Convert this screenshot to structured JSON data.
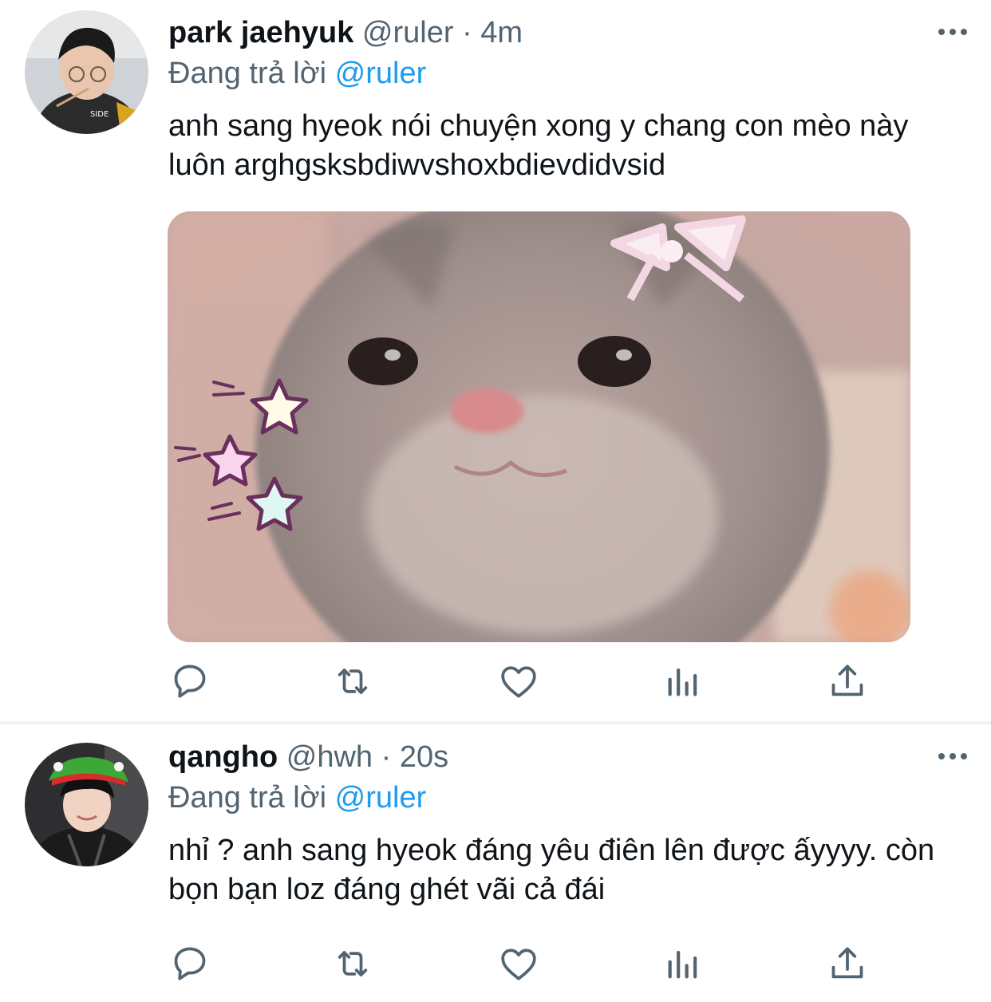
{
  "tweets": [
    {
      "name": "park jaehyuk",
      "handle": "@ruler",
      "separator": "·",
      "time": "4m",
      "reply_prefix": "Đang trả lời",
      "reply_to": "@ruler",
      "text": "anh sang hyeok nói chuyện xong y chang con mèo này luôn arghgsksbdiwvshoxbdievdidvsid",
      "has_media": true
    },
    {
      "name": "qangho",
      "handle": "@hwh",
      "separator": "·",
      "time": "20s",
      "reply_prefix": "Đang trả lời",
      "reply_to": "@ruler",
      "text": "nhỉ ? anh sang hyeok đáng yêu điên lên được ấyyyy. còn bọn bạn loz đáng ghét vãi cả đái",
      "has_media": false
    }
  ],
  "icons": {
    "more": "more-icon",
    "reply": "reply-icon",
    "retweet": "retweet-icon",
    "like": "heart-icon",
    "stats": "stats-icon",
    "share": "share-icon"
  },
  "colors": {
    "text": "#0f1419",
    "secondary": "#536471",
    "accent": "#1d9bf0",
    "separator": "#eff3f4"
  }
}
